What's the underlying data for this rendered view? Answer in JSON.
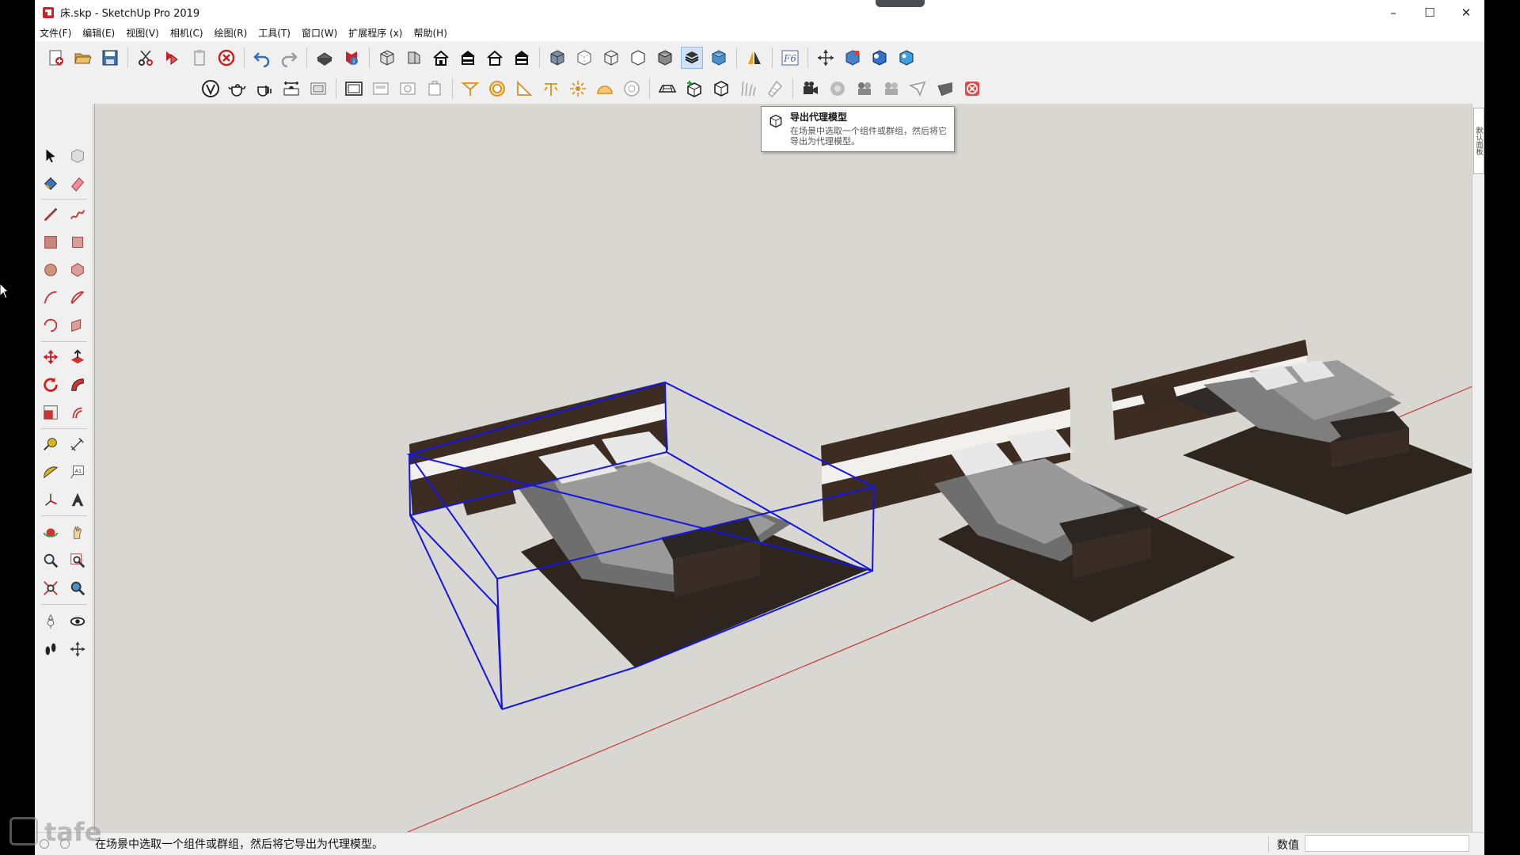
{
  "window": {
    "title": "床.skp - SketchUp Pro 2019",
    "minimize": "–",
    "maximize": "☐",
    "close": "✕"
  },
  "menu": {
    "items": [
      "文件(F)",
      "编辑(E)",
      "视图(V)",
      "相机(C)",
      "绘图(R)",
      "工具(T)",
      "窗口(W)",
      "扩展程序 (x)",
      "帮助(H)"
    ]
  },
  "toolbar_row1": [
    "new-file-icon",
    "open-file-icon",
    "save-icon",
    "cut-icon",
    "copy-icon",
    "paste-icon",
    "erase-icon",
    "undo-icon",
    "redo-icon",
    "print-icon",
    "model-info-icon",
    "iso-view-icon",
    "top-view-icon",
    "front-view-icon",
    "right-view-icon",
    "back-view-icon",
    "left-view-icon",
    "xray-icon",
    "back-edges-icon",
    "wireframe-icon",
    "hidden-line-icon",
    "shaded-icon",
    "shaded-textures-icon",
    "monochrome-icon",
    "section-plane-icon",
    "fredo-icon",
    "orbit-icon",
    "component-icon",
    "vray-sphere-icon",
    "vray-render-icon"
  ],
  "toolbar_row2": [
    "vray-logo-icon",
    "teapot-icon",
    "teapot-interactive-icon",
    "frame-buffer-icon",
    "frame-icon",
    "rect-light-icon",
    "omni-icon",
    "spot-icon",
    "ies-icon",
    "sphere-light-icon",
    "dome-light-icon",
    "mesh-light-icon",
    "infinite-plane-icon",
    "export-proxy-icon",
    "import-proxy-icon",
    "fur-icon",
    "clipper-icon",
    "camera-icon",
    "material-icon",
    "batch-icon",
    "batch2-icon",
    "plane-icon",
    "object-icon",
    "close-red-icon"
  ],
  "tooltip": {
    "title": "导出代理模型",
    "description": "在场景中选取一个组件或群组，然后将它导出为代理模型。"
  },
  "status": {
    "message": "在场景中选取一个组件或群组，然后将它导出为代理模型。",
    "value_label": "数值",
    "value": ""
  },
  "tray": {
    "tab_label": "默认面板"
  },
  "watermark": {
    "text": "tafe"
  },
  "colors": {
    "viewport_bg": "#d9d7d2",
    "selection_blue": "#1414e8",
    "axis_red": "#c33a3a",
    "wood_dark": "#3f2e25",
    "rug": "#2f261f"
  }
}
